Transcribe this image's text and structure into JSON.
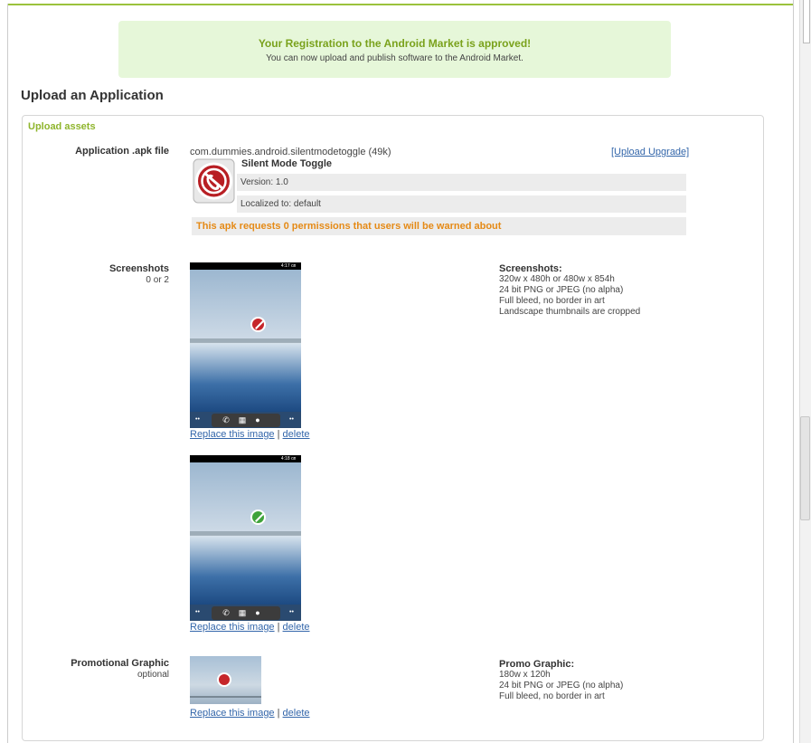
{
  "banner": {
    "title": "Your Registration to the Android Market is approved!",
    "subtitle": "You can now upload and publish software to the Android Market."
  },
  "page": {
    "title": "Upload an Application"
  },
  "panel": {
    "title": "Upload assets"
  },
  "apk": {
    "label": "Application .apk file",
    "file_name": "com.dummies.android.silentmodetoggle (49k)",
    "upload_upgrade_link": "[Upload Upgrade]",
    "app_name": "Silent Mode Toggle",
    "version": "Version: 1.0",
    "localized": "Localized to: default",
    "permissions_notice": "This apk requests 0 permissions that users will be warned about",
    "icon": "silent-mode-icon"
  },
  "screenshots": {
    "label": "Screenshots",
    "sublabel": "0 or 2",
    "items": [
      {
        "status_time": "4:17 ㎝",
        "icon_color": "#c6262a"
      },
      {
        "status_time": "4:18 ㎝",
        "icon_color": "#3fa33a"
      }
    ],
    "replace_link": "Replace this image",
    "separator": "|",
    "delete_link": "delete",
    "spec_title": "Screenshots:",
    "spec_lines": [
      "320w x 480h or 480w x 854h",
      "24 bit PNG or JPEG (no alpha)",
      "Full bleed, no border in art",
      "Landscape thumbnails are cropped"
    ]
  },
  "promo": {
    "label": "Promotional Graphic",
    "sublabel": "optional",
    "replace_link": "Replace this image",
    "separator": "|",
    "delete_link": "delete",
    "spec_title": "Promo Graphic:",
    "spec_lines": [
      "180w x 120h",
      "24 bit PNG or JPEG (no alpha)",
      "Full bleed, no border in art"
    ]
  },
  "colors": {
    "accent_green": "#8fb52d",
    "banner_bg": "#e6f7d9",
    "warning_orange": "#e58a16",
    "link_blue": "#3366aa"
  }
}
